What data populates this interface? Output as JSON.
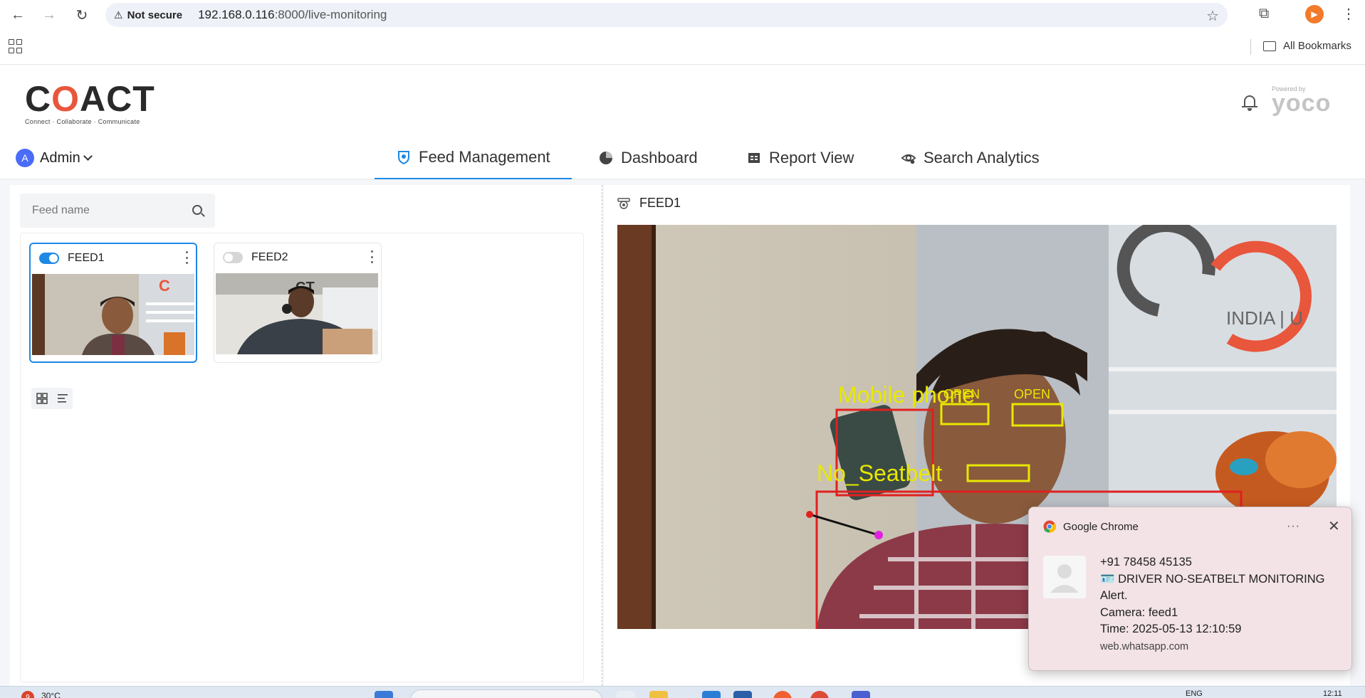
{
  "browser": {
    "not_secure_label": "Not secure",
    "url_host": "192.168.0.116",
    "url_port_path": ":8000/live-monitoring",
    "bookmarks_label": "All Bookmarks"
  },
  "app": {
    "logo_text_pre": "C",
    "logo_text_o": "O",
    "logo_text_post": "ACT",
    "logo_tagline": "Connect · Collaborate · Communicate",
    "powered_by": "Powered by",
    "partner_logo": "yoco"
  },
  "user": {
    "avatar_letter": "A",
    "name": "Admin"
  },
  "nav": {
    "tabs": [
      {
        "label": "Feed Management",
        "icon": "camera-shield-icon",
        "active": true
      },
      {
        "label": "Dashboard",
        "icon": "pie-chart-icon",
        "active": false
      },
      {
        "label": "Report View",
        "icon": "report-icon",
        "active": false
      },
      {
        "label": "Search Analytics",
        "icon": "eye-gear-icon",
        "active": false
      }
    ]
  },
  "search": {
    "placeholder": "Feed name",
    "value": ""
  },
  "feeds": [
    {
      "name": "FEED1",
      "enabled": true,
      "selected": true
    },
    {
      "name": "FEED2",
      "enabled": false,
      "selected": false
    }
  ],
  "viewer": {
    "title": "FEED1",
    "detections": [
      {
        "label": "Mobile phone",
        "color": "#e8e800"
      },
      {
        "label": "OPEN",
        "color": "#e8e800"
      },
      {
        "label": "OPEN",
        "color": "#e8e800"
      },
      {
        "label": "No_Seatbelt",
        "color": "#e8e800"
      }
    ],
    "wall_text": "INDIA | U"
  },
  "notification": {
    "app": "Google Chrome",
    "more": "···",
    "sender": "+91 78458 45135",
    "line1": "🪪 DRIVER NO-SEATBELT MONITORING",
    "line2": "Alert.",
    "line3": "Camera: feed1",
    "line4": "Time: 2025-05-13 12:10:59",
    "site": "web.whatsapp.com"
  },
  "taskbar": {
    "weather_badge": "9",
    "weather_temp": "30°C",
    "lang": "ENG",
    "time": "12:11"
  },
  "colors": {
    "accent": "#1e88e5",
    "brand_orange": "#e8563c",
    "detect_red": "#e02020",
    "detect_yellow": "#e8e800"
  }
}
